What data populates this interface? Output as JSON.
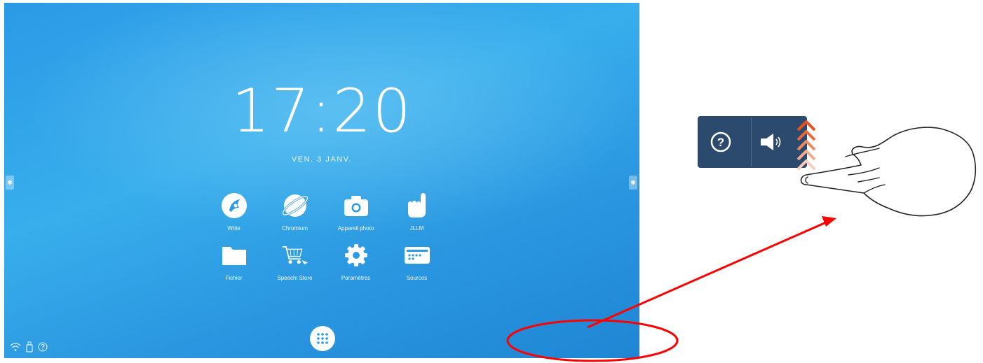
{
  "clock": {
    "time": "17:20",
    "date": "VEN. 3 JANV."
  },
  "apps": [
    {
      "label": "Write",
      "icon": "write-icon"
    },
    {
      "label": "Chromium",
      "icon": "chromium-icon"
    },
    {
      "label": "Appareil photo",
      "icon": "camera-icon"
    },
    {
      "label": "JLLM",
      "icon": "hand-logo-icon"
    },
    {
      "label": "Fichier",
      "icon": "folder-icon"
    },
    {
      "label": "Speechi Store",
      "icon": "store-cart-icon"
    },
    {
      "label": "Paramètres",
      "icon": "settings-gear-icon"
    },
    {
      "label": "Sources",
      "icon": "sources-icon"
    }
  ],
  "status_bar": {
    "icons": [
      "wifi-icon",
      "usb-icon",
      "help-icon"
    ]
  },
  "side_menu_glyph": "✱",
  "zoom_panel": {
    "help_glyph": "?",
    "icons": [
      "help-circle-icon",
      "volume-icon"
    ]
  },
  "annotation": {
    "arrow_color": "#ff0000",
    "ellipse_color": "#ff0000",
    "swipe_arrow_color": "#e8521c"
  },
  "colors": {
    "screen_blue": "#2b9ae6",
    "panel_navy": "#2c4a6d"
  }
}
